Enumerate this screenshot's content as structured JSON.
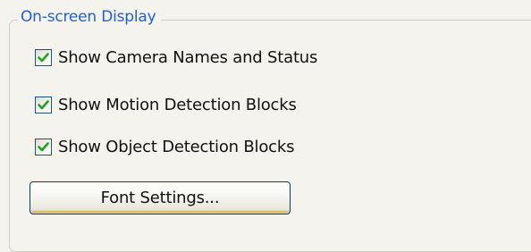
{
  "group": {
    "title": "On-screen Display"
  },
  "options": [
    {
      "label": "Show Camera Names and Status",
      "checked": true
    },
    {
      "label": "Show Motion Detection Blocks",
      "checked": true
    },
    {
      "label": "Show Object Detection Blocks",
      "checked": true
    }
  ],
  "buttons": {
    "font_settings_label": "Font Settings..."
  },
  "colors": {
    "group_title": "#1f5fd8",
    "checkmark": "#21a121",
    "checkbox_border": "#1c5180"
  }
}
